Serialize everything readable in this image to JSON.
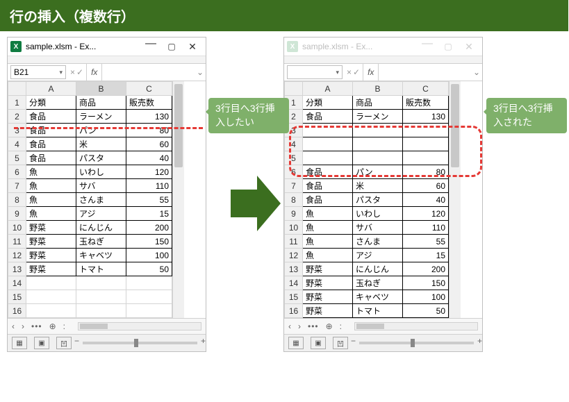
{
  "title": "行の挿入（複数行）",
  "window": {
    "app_icon_text": "X",
    "title_text": "sample.xlsm - Ex...",
    "name_box": "B21",
    "fx_label": "fx",
    "fx_cancel": "×",
    "fx_confirm": "✓",
    "columns": [
      "A",
      "B",
      "C"
    ],
    "view_icons": [
      "▦",
      "▣",
      "凹"
    ]
  },
  "callouts": {
    "left": "3行目へ3行挿入したい",
    "right": "3行目へ3行挿入された"
  },
  "headers": {
    "a": "分類",
    "b": "商品",
    "c": "販売数"
  },
  "left_rows": [
    {
      "n": 1,
      "a": "分類",
      "b": "商品",
      "c": "販売数",
      "hdr": true
    },
    {
      "n": 2,
      "a": "食品",
      "b": "ラーメン",
      "c": "130"
    },
    {
      "n": 3,
      "a": "食品",
      "b": "パン",
      "c": "80"
    },
    {
      "n": 4,
      "a": "食品",
      "b": "米",
      "c": "60"
    },
    {
      "n": 5,
      "a": "食品",
      "b": "パスタ",
      "c": "40"
    },
    {
      "n": 6,
      "a": "魚",
      "b": "いわし",
      "c": "120"
    },
    {
      "n": 7,
      "a": "魚",
      "b": "サバ",
      "c": "110"
    },
    {
      "n": 8,
      "a": "魚",
      "b": "さんま",
      "c": "55"
    },
    {
      "n": 9,
      "a": "魚",
      "b": "アジ",
      "c": "15"
    },
    {
      "n": 10,
      "a": "野菜",
      "b": "にんじん",
      "c": "200"
    },
    {
      "n": 11,
      "a": "野菜",
      "b": "玉ねぎ",
      "c": "150"
    },
    {
      "n": 12,
      "a": "野菜",
      "b": "キャベツ",
      "c": "100"
    },
    {
      "n": 13,
      "a": "野菜",
      "b": "トマト",
      "c": "50"
    },
    {
      "n": 14,
      "a": "",
      "b": "",
      "c": "",
      "empty": true
    },
    {
      "n": 15,
      "a": "",
      "b": "",
      "c": "",
      "empty": true
    },
    {
      "n": 16,
      "a": "",
      "b": "",
      "c": "",
      "empty": true
    }
  ],
  "right_rows": [
    {
      "n": 1,
      "a": "分類",
      "b": "商品",
      "c": "販売数",
      "hdr": true
    },
    {
      "n": 2,
      "a": "食品",
      "b": "ラーメン",
      "c": "130"
    },
    {
      "n": 3,
      "a": "",
      "b": "",
      "c": "",
      "ins": true
    },
    {
      "n": 4,
      "a": "",
      "b": "",
      "c": "",
      "ins": true
    },
    {
      "n": 5,
      "a": "",
      "b": "",
      "c": "",
      "ins": true
    },
    {
      "n": 6,
      "a": "食品",
      "b": "パン",
      "c": "80"
    },
    {
      "n": 7,
      "a": "食品",
      "b": "米",
      "c": "60"
    },
    {
      "n": 8,
      "a": "食品",
      "b": "パスタ",
      "c": "40"
    },
    {
      "n": 9,
      "a": "魚",
      "b": "いわし",
      "c": "120"
    },
    {
      "n": 10,
      "a": "魚",
      "b": "サバ",
      "c": "110"
    },
    {
      "n": 11,
      "a": "魚",
      "b": "さんま",
      "c": "55"
    },
    {
      "n": 12,
      "a": "魚",
      "b": "アジ",
      "c": "15"
    },
    {
      "n": 13,
      "a": "野菜",
      "b": "にんじん",
      "c": "200"
    },
    {
      "n": 14,
      "a": "野菜",
      "b": "玉ねぎ",
      "c": "150"
    },
    {
      "n": 15,
      "a": "野菜",
      "b": "キャベツ",
      "c": "100"
    },
    {
      "n": 16,
      "a": "野菜",
      "b": "トマト",
      "c": "50"
    }
  ]
}
